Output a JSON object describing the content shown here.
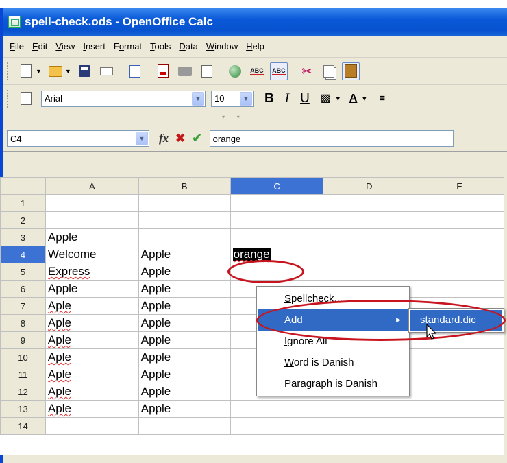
{
  "window": {
    "title": "spell-check.ods - OpenOffice Calc"
  },
  "menu": [
    {
      "pre": "",
      "u": "F",
      "post": "ile"
    },
    {
      "pre": "",
      "u": "E",
      "post": "dit"
    },
    {
      "pre": "",
      "u": "V",
      "post": "iew"
    },
    {
      "pre": "",
      "u": "I",
      "post": "nsert"
    },
    {
      "pre": "F",
      "u": "o",
      "post": "rmat"
    },
    {
      "pre": "",
      "u": "T",
      "post": "ools"
    },
    {
      "pre": "",
      "u": "D",
      "post": "ata"
    },
    {
      "pre": "",
      "u": "W",
      "post": "indow"
    },
    {
      "pre": "",
      "u": "H",
      "post": "elp"
    }
  ],
  "formatting": {
    "font_name": "Arial",
    "font_size": "10",
    "bold": "B",
    "italic": "I",
    "underline": "U"
  },
  "formula_bar": {
    "name_box": "C4",
    "fx": "fx",
    "cancel": "✖",
    "accept": "✔",
    "content": "orange"
  },
  "sheet": {
    "columns": [
      "A",
      "B",
      "C",
      "D",
      "E"
    ],
    "active_column": "C",
    "active_row": "4",
    "rows": [
      {
        "num": "1",
        "a": "",
        "b": "",
        "c": ""
      },
      {
        "num": "2",
        "a": "",
        "b": "",
        "c": ""
      },
      {
        "num": "3",
        "a": "Apple",
        "b": "",
        "c": ""
      },
      {
        "num": "4",
        "a": "Welcome",
        "b": "Apple",
        "c": "orange"
      },
      {
        "num": "5",
        "a": "Express",
        "b": "Apple",
        "c": ""
      },
      {
        "num": "6",
        "a": "Apple",
        "b": "Apple",
        "c": ""
      },
      {
        "num": "7",
        "a": "Aple",
        "b": "Apple",
        "c": ""
      },
      {
        "num": "8",
        "a": "Aple",
        "b": "Apple",
        "c": ""
      },
      {
        "num": "9",
        "a": "Aple",
        "b": "Apple",
        "c": ""
      },
      {
        "num": "10",
        "a": "Aple",
        "b": "Apple",
        "c": ""
      },
      {
        "num": "11",
        "a": "Aple",
        "b": "Apple",
        "c": ""
      },
      {
        "num": "12",
        "a": "Aple",
        "b": "Apple",
        "c": ""
      },
      {
        "num": "13",
        "a": "Aple",
        "b": "Apple",
        "c": ""
      },
      {
        "num": "14",
        "a": "",
        "b": "",
        "c": ""
      }
    ]
  },
  "context_menu": [
    {
      "pre": "",
      "u": "S",
      "post": "pellcheck..."
    },
    {
      "pre": "",
      "u": "A",
      "post": "dd"
    },
    {
      "pre": "",
      "u": "I",
      "post": "gnore All"
    },
    {
      "pre": "",
      "u": "W",
      "post": "ord is Danish"
    },
    {
      "pre": "",
      "u": "P",
      "post": "aragraph is Danish"
    }
  ],
  "submenu": {
    "item": "standard.dic"
  },
  "colors": {
    "titlebar": "#0a59d8",
    "highlight": "#316ac5",
    "annotation": "#c8141e",
    "misspelling": "#e03030"
  }
}
